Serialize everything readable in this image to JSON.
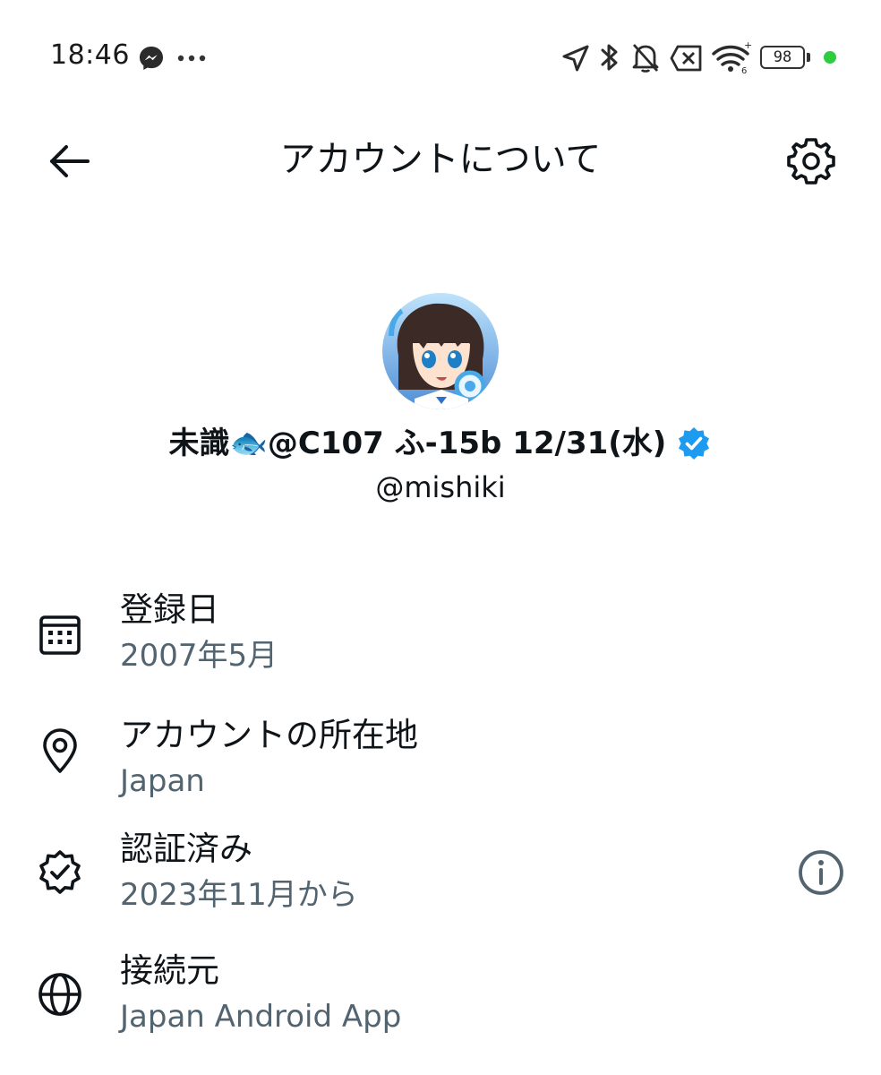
{
  "status_bar": {
    "time": "18:46",
    "battery_level": "98",
    "icons": [
      "messenger-icon",
      "more-dots-icon",
      "location-icon",
      "bluetooth-icon",
      "bell-off-icon",
      "no-sim-icon",
      "wifi-icon",
      "battery-icon"
    ],
    "indicator_color": "#2ecc40"
  },
  "header": {
    "title": "アカウントについて",
    "back_icon": "arrow-left-icon",
    "settings_icon": "gear-icon"
  },
  "profile": {
    "display_name": "未識🐟@C107 ふ-15b 12/31(水)",
    "handle": "@mishiki",
    "verified": true,
    "verified_color": "#1d9bf0"
  },
  "info_rows": [
    {
      "label": "登録日",
      "value": "2007年5月",
      "icon": "calendar-icon"
    },
    {
      "label": "アカウントの所在地",
      "value": "Japan",
      "icon": "location-pin-icon"
    },
    {
      "label": "認証済み",
      "value": "2023年11月から",
      "icon": "verified-badge-icon",
      "has_info_button": true
    },
    {
      "label": "接続元",
      "value": "Japan Android App",
      "icon": "globe-icon"
    }
  ],
  "colors": {
    "text_primary": "#0f1419",
    "text_secondary": "#536471",
    "accent": "#1d9bf0"
  }
}
